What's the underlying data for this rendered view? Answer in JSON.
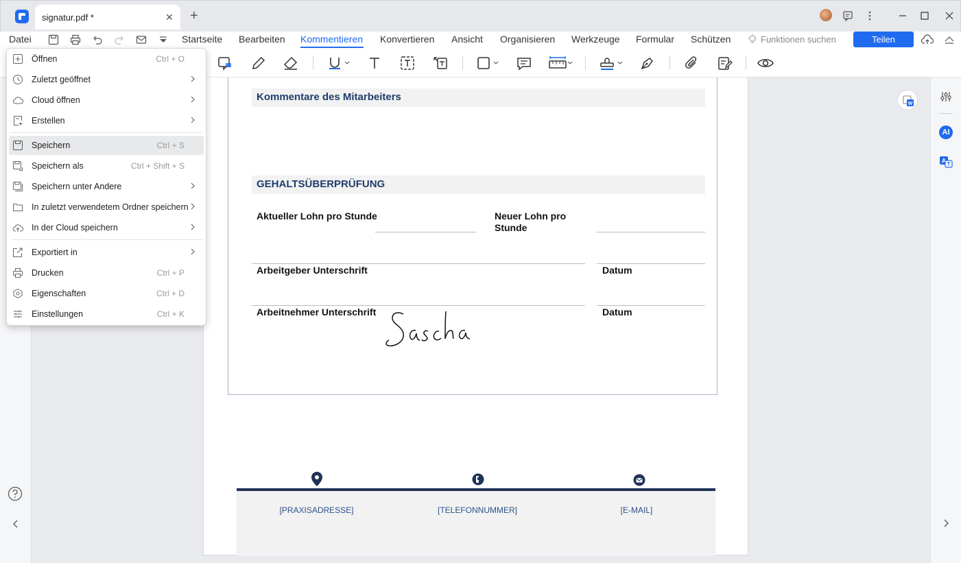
{
  "window": {
    "tab_title": "signatur.pdf *",
    "tab_close": "✕",
    "new_tab": "+"
  },
  "menubar": {
    "file": "Datei",
    "items": [
      "Startseite",
      "Bearbeiten",
      "Kommentieren",
      "Konvertieren",
      "Ansicht",
      "Organisieren",
      "Werkzeuge",
      "Formular",
      "Schützen"
    ],
    "active": "Kommentieren",
    "search_features": "Funktionen suchen",
    "share": "Teilen"
  },
  "dropdown": {
    "items": [
      {
        "label": "Öffnen",
        "shortcut": "Ctrl + O",
        "submenu": false,
        "icon": "plus-box-icon"
      },
      {
        "label": "Zuletzt geöffnet",
        "shortcut": "",
        "submenu": true,
        "icon": "clock-icon"
      },
      {
        "label": "Cloud öffnen",
        "shortcut": "",
        "submenu": true,
        "icon": "cloud-icon"
      },
      {
        "label": "Erstellen",
        "shortcut": "",
        "submenu": true,
        "icon": "create-file-icon"
      },
      {
        "label": "Speichern",
        "shortcut": "Ctrl + S",
        "submenu": false,
        "icon": "save-icon",
        "highlight": true
      },
      {
        "label": "Speichern als",
        "shortcut": "Ctrl + Shift + S",
        "submenu": false,
        "icon": "save-as-icon"
      },
      {
        "label": "Speichern unter Andere",
        "shortcut": "",
        "submenu": true,
        "icon": "save-other-icon"
      },
      {
        "label": "In zuletzt verwendetem Ordner speichern",
        "shortcut": "",
        "submenu": true,
        "icon": "folder-icon"
      },
      {
        "label": "In der Cloud speichern",
        "shortcut": "",
        "submenu": true,
        "icon": "cloud-upload-icon"
      },
      {
        "label": "Exportiert in",
        "shortcut": "",
        "submenu": true,
        "icon": "export-icon"
      },
      {
        "label": "Drucken",
        "shortcut": "Ctrl + P",
        "submenu": false,
        "icon": "print-icon"
      },
      {
        "label": "Eigenschaften",
        "shortcut": "Ctrl + D",
        "submenu": false,
        "icon": "properties-icon"
      },
      {
        "label": "Einstellungen",
        "shortcut": "Ctrl + K",
        "submenu": false,
        "icon": "settings-sliders-icon"
      }
    ]
  },
  "document": {
    "section1_title": "Kommentare des Mitarbeiters",
    "section2_title": "GEHALTSÜBERPRÜFUNG",
    "current_wage": "Aktueller Lohn pro Stunde",
    "new_wage": "Neuer Lohn pro Stunde",
    "employer_signature": "Arbeitgeber Unterschrift",
    "date1": "Datum",
    "employee_signature": "Arbeitnehmer Unterschrift",
    "date2": "Datum",
    "signature_text": "Sascha",
    "footer": {
      "address": "[PRAXISADRESSE]",
      "phone": "[TELEFONNUMMER]",
      "email": "[E-MAIL]"
    }
  },
  "right_panel": {
    "ai_label": "AI"
  },
  "colors": {
    "accent": "#1f6bf0",
    "heading": "#1f3d6b",
    "footer_bar": "#1f3356"
  }
}
